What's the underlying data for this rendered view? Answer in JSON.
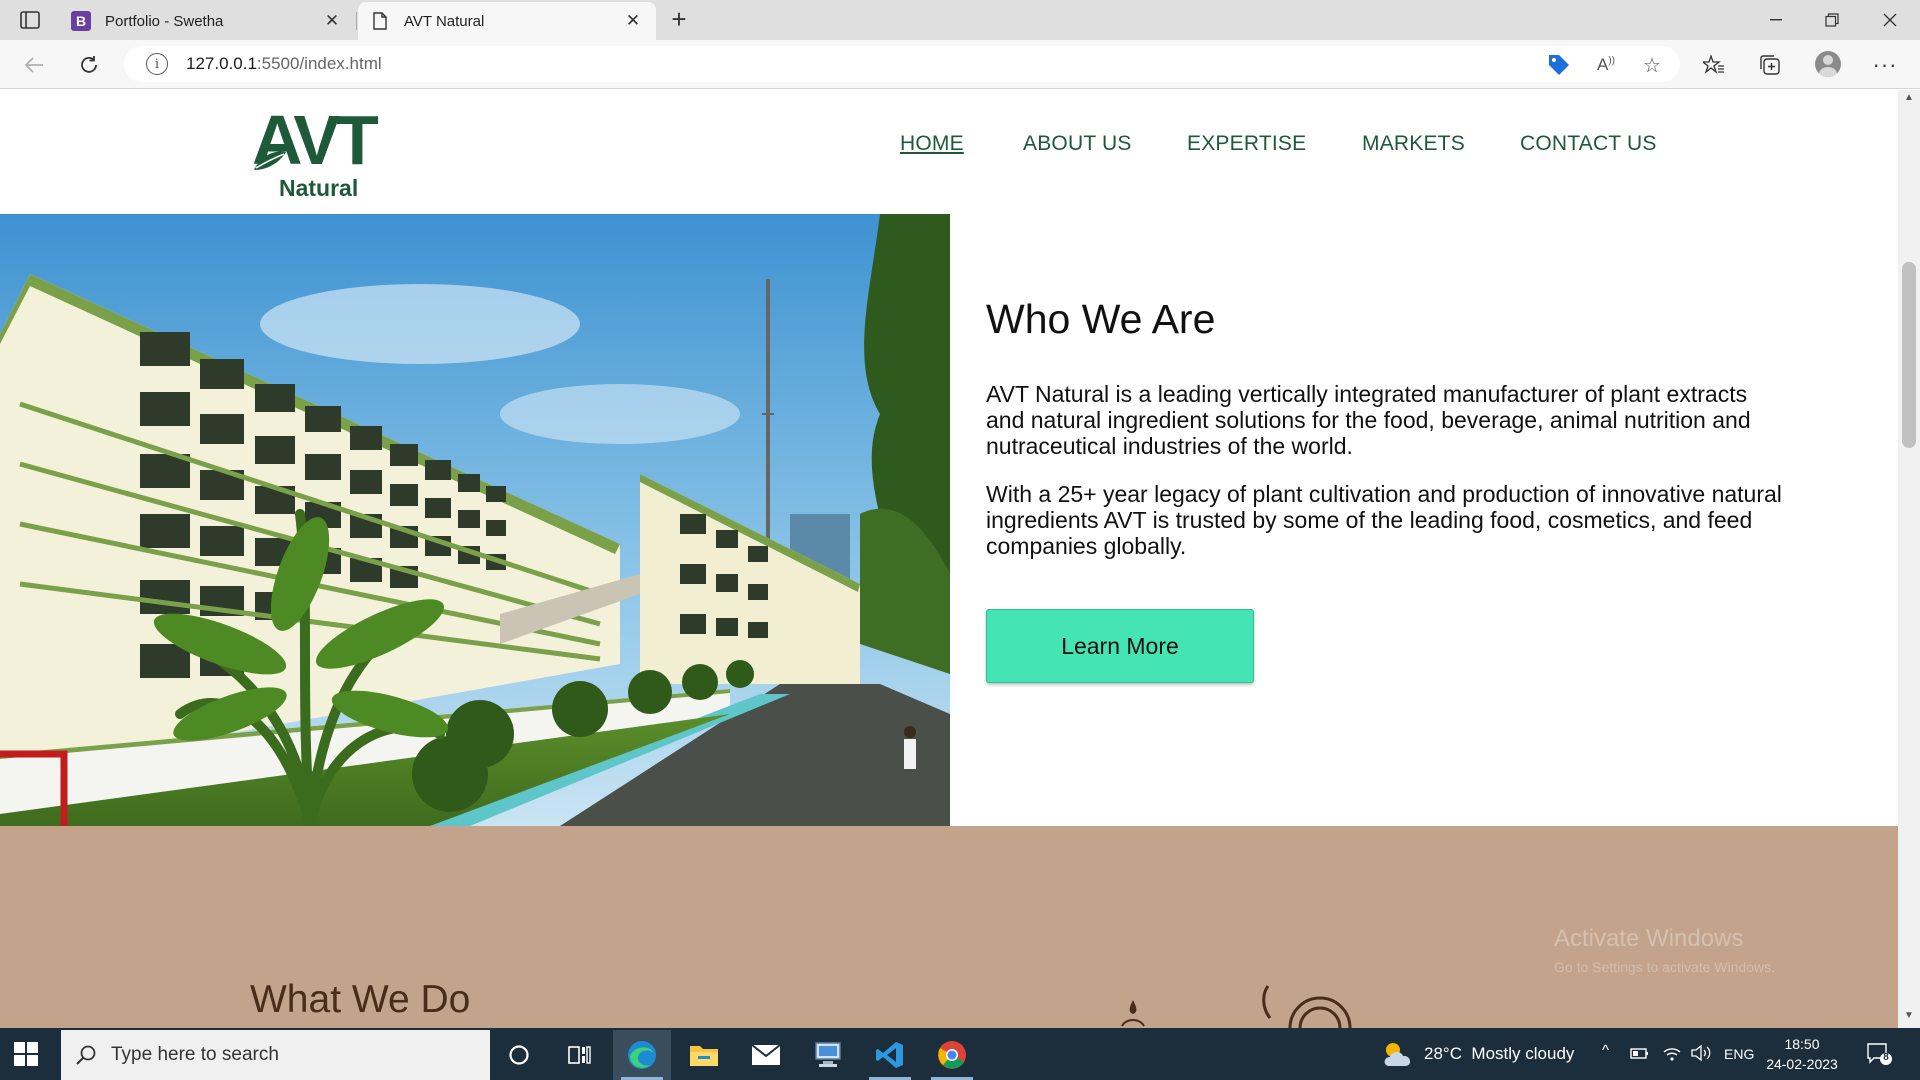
{
  "browser": {
    "tabs": [
      {
        "title": "Portfolio - Swetha",
        "favicon": "B"
      },
      {
        "title": "AVT Natural"
      }
    ],
    "url_host": "127.0.0.1",
    "url_rest": ":5500/index.html"
  },
  "site": {
    "logo": {
      "mark": "AVT",
      "word": "Natural",
      "color": "#1e5a3a"
    },
    "nav": [
      {
        "label": "HOME",
        "active": true
      },
      {
        "label": "ABOUT US"
      },
      {
        "label": "EXPERTISE"
      },
      {
        "label": "MARKETS"
      },
      {
        "label": "CONTACT US"
      }
    ],
    "who": {
      "title": "Who We Are",
      "p1": "AVT Natural is a leading vertically integrated manufacturer of plant extracts and natural ingredient solutions for the food, beverage, animal nutrition and nutraceutical industries of the world.",
      "p2": "With a 25+ year legacy of plant cultivation and production of innovative natural ingredients AVT is trusted by some of the leading food, cosmetics, and feed companies globally.",
      "button": "Learn More",
      "button_color": "#45e4b5"
    },
    "what": {
      "title": "What We Do",
      "bg_color": "#c3a38b"
    },
    "watermark": {
      "line1": "Activate Windows",
      "line2": "Go to Settings to activate Windows."
    }
  },
  "taskbar": {
    "search_placeholder": "Type here to search",
    "weather": "28°C  Mostly cloudy",
    "lang": "ENG",
    "time": "18:50",
    "date": "24-02-2023",
    "notifications": "8"
  }
}
